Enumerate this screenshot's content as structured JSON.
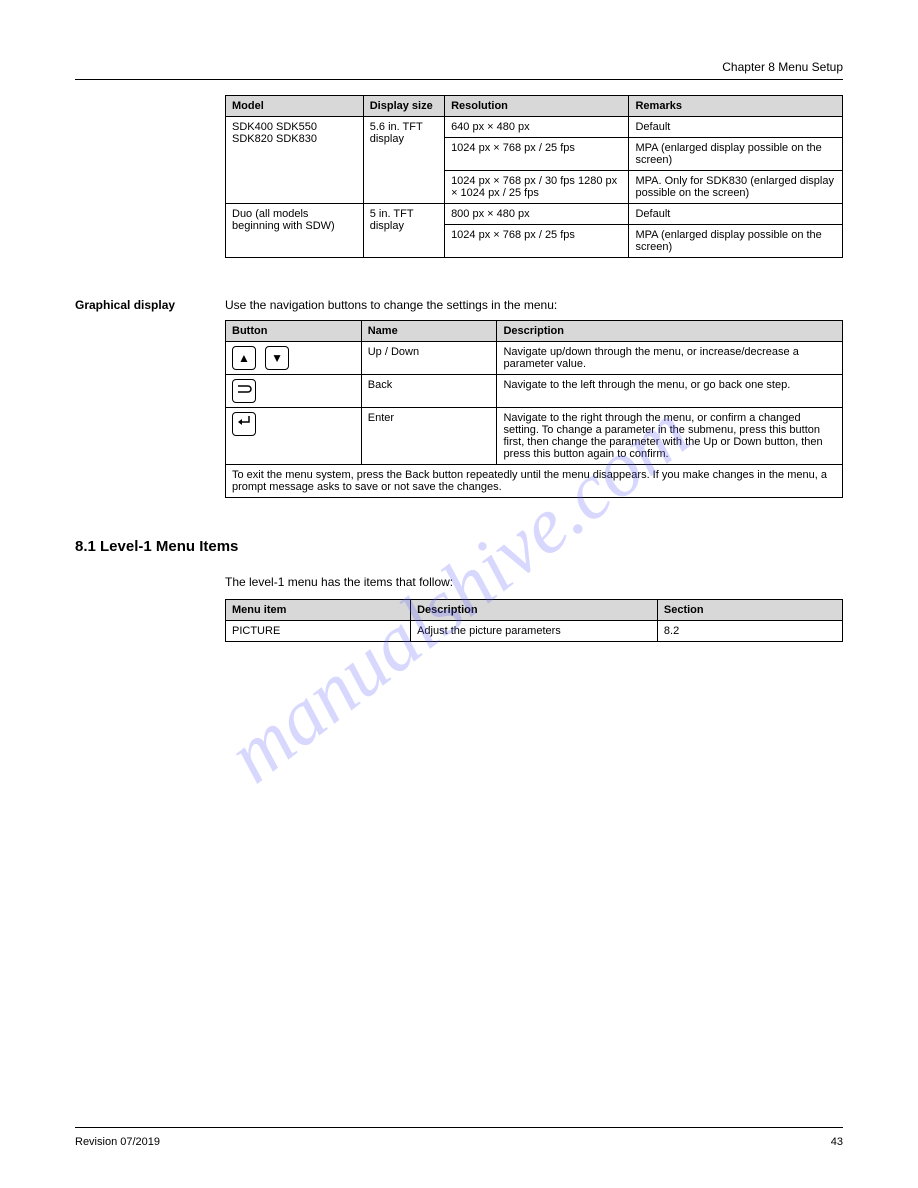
{
  "header": {
    "left": "",
    "right": "Chapter 8 Menu Setup"
  },
  "section1": {
    "tableHeaders": [
      "Model",
      "Display size",
      "Resolution",
      "Remarks"
    ],
    "rows": [
      {
        "model": "SDK400 SDK550 SDK820 SDK830",
        "display": "5.6 in. TFT display",
        "resCells": [
          "640 px × 480 px",
          "1024 px × 768 px / 25 fps",
          "1024 px × 768 px / 30 fps 1280 px × 1024 px / 25 fps"
        ],
        "remCells": [
          "Default",
          "MPA (enlarged display possible on the screen)",
          "MPA. Only for SDK830 (enlarged display possible on the screen)"
        ]
      },
      {
        "model": "Duo (all models beginning with SDW)",
        "display": "5 in. TFT display",
        "resCells": [
          "800 px × 480 px",
          "1024 px × 768 px / 25 fps"
        ],
        "remCells": [
          "Default",
          "MPA (enlarged display possible on the screen)"
        ]
      }
    ]
  },
  "section2": {
    "label": "Graphical display",
    "intro": "Use the navigation buttons to change the settings in the menu:",
    "headers": [
      "Button",
      "Name",
      "Description"
    ],
    "rows": [
      {
        "icons": [
          "up",
          "down"
        ],
        "name": "Up / Down",
        "desc": "Navigate up/down through the menu, or increase/decrease a parameter value."
      },
      {
        "icons": [
          "back"
        ],
        "name": "Back",
        "desc": "Navigate to the left through the menu, or go back one step."
      },
      {
        "icons": [
          "enter"
        ],
        "name": "Enter",
        "desc": "Navigate to the right through the menu, or confirm a changed setting. To change a parameter in the submenu, press this button first, then change the parameter with the Up or Down button, then press this button again to confirm."
      }
    ],
    "note": "To exit the menu system, press the Back button repeatedly until the menu disappears. If you make changes in the menu, a prompt message asks to save or not save the changes."
  },
  "section3": {
    "heading": "8.1  Level-1 Menu Items",
    "intro": "The level-1 menu has the items that follow:",
    "headers": [
      "Menu item",
      "Description",
      "Section"
    ],
    "rows": [
      {
        "item": "PICTURE",
        "desc": "Adjust the picture parameters",
        "section": "8.2"
      }
    ]
  },
  "footer": {
    "left": "Revision 07/2019",
    "right": "43"
  },
  "watermark": "manualshive.com"
}
